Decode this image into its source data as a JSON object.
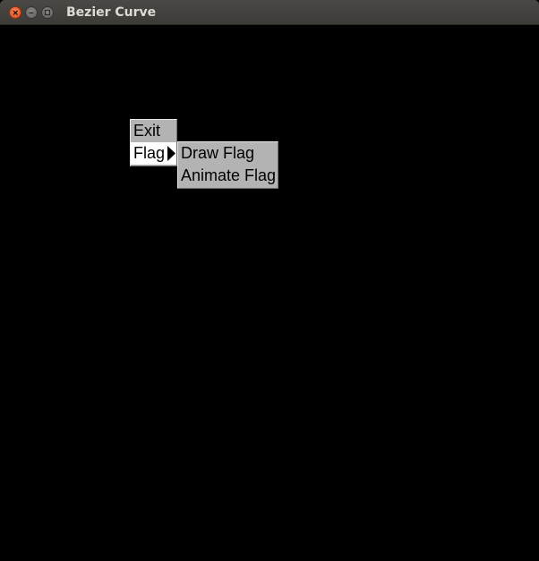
{
  "window": {
    "title": "Bezier Curve"
  },
  "menu": {
    "items": [
      {
        "label": "Exit"
      },
      {
        "label": "Flag",
        "has_submenu": true,
        "highlighted": true
      }
    ],
    "submenu": {
      "items": [
        {
          "label": "Draw Flag"
        },
        {
          "label": "Animate Flag"
        }
      ]
    }
  },
  "icons": {
    "close": "close-icon",
    "minimize": "minimize-icon",
    "maximize": "maximize-icon",
    "submenu_arrow": "triangle-right-icon"
  },
  "colors": {
    "canvas_background": "#000000",
    "menu_background": "#b3b3b3",
    "menu_highlight": "#ffffff",
    "titlebar": "#3c3b37",
    "close_button": "#e0582a"
  }
}
